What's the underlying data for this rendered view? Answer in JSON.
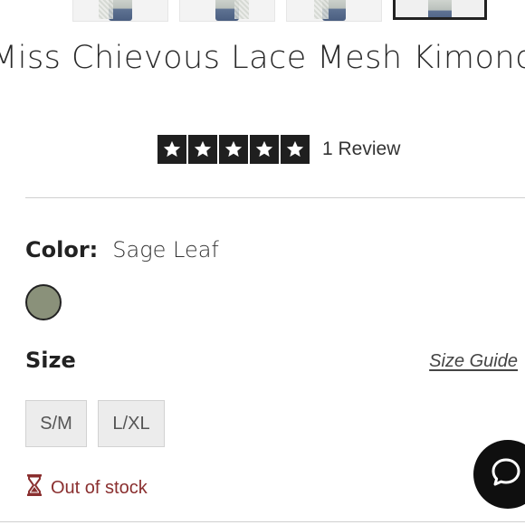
{
  "product": {
    "title": "Miss Chievous Lace Mesh Kimono",
    "rating": {
      "stars": 5,
      "review_text": "1 Review"
    },
    "color": {
      "label": "Color:",
      "selected": "Sage Leaf",
      "swatch_hex": "#8a917a"
    },
    "size": {
      "label": "Size",
      "guide_link": "Size Guide",
      "options": [
        "S/M",
        "L/XL"
      ]
    },
    "stock_status": "Out of stock"
  },
  "icons": {
    "star": "star-icon",
    "hourglass": "hourglass-icon",
    "chat": "chat-bubble-icon"
  },
  "colors": {
    "out_of_stock": "#8a2f2f",
    "star_bg": "#1f1f1f"
  }
}
